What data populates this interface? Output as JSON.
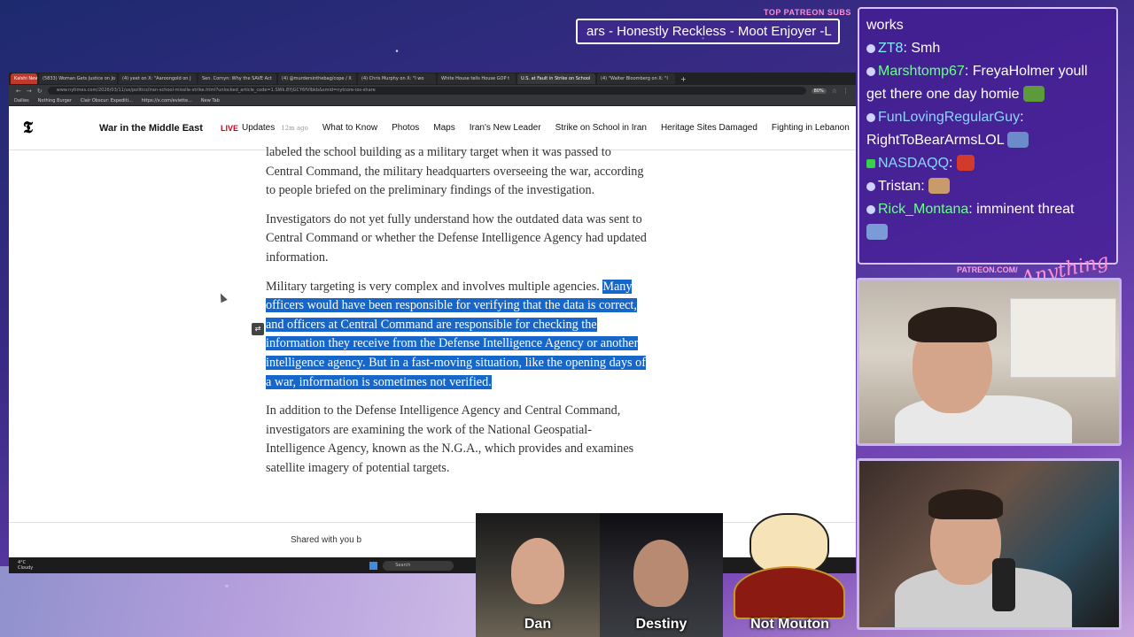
{
  "patreon_banner": {
    "label": "TOP PATREON SUBS",
    "marquee": "ars - Honestly Reckless - Moot Enjoyer -L"
  },
  "browser": {
    "tabs": [
      "Kalshi News",
      "(5833) Woman Gets Justice on Jo",
      "(4) yeet on X: \"Aaroongold on J",
      "Sen. Cornyn: Why the SAVE Act",
      "(4) @murdersinthebag/cope / X",
      "(4) Chris Murphy on X: \"I wo",
      "White House tells House GOP t",
      "U.S. at Fault in Strike on School",
      "(4) \"Walter Bloomberg on X: \"I"
    ],
    "active_tab_index": 7,
    "url": "www.nytimes.com/2026/03/11/us/politics/iran-school-missile-strike.html?unlocked_article_code=1.SWk.8YjGCY6fVIbkb&smid=nytcore-ios-share",
    "zoom": "80%",
    "bookmarks": [
      "Dailies",
      "Nothing Burger",
      "Clair Obscur: Expediti...",
      "https://x.com/eviette...",
      "New Tab"
    ]
  },
  "nyt_nav": {
    "section_title": "War in the Middle East",
    "live_badge": "LIVE",
    "live_label": "Updates",
    "live_time": "12m ago",
    "links": [
      "What to Know",
      "Photos",
      "Maps",
      "Iran's New Leader",
      "Strike on School in Iran",
      "Heritage Sites Damaged",
      "Fighting in Lebanon"
    ]
  },
  "article": {
    "p1": "labeled the school building as a military target when it was passed to Central Command, the military headquarters overseeing the war, according to people briefed on the preliminary findings of the investigation.",
    "p2": "Investigators do not yet fully understand how the outdated data was sent to Central Command or whether the Defense Intelligence Agency had updated information.",
    "p3_lead": "Military targeting is very complex and involves multiple agencies.",
    "p3_highlighted": "Many officers would have been responsible for verifying that the data is correct, and officers at Central Command are responsible for checking the information they receive from the Defense Intelligence Agency or another intelligence agency. But in a fast-moving situation, like the opening days of a war, information is sometimes not verified.",
    "p4": "In addition to the Defense Intelligence Agency and Central Command, investigators are examining the work of the National Geospatial-Intelligence Agency, known as the N.G.A., which provides and examines satellite imagery of potential targets.",
    "shared_text": "Shared with you b"
  },
  "taskbar": {
    "weather_temp": "4°C",
    "weather_desc": "Cloudy",
    "search": "Search"
  },
  "chat": {
    "messages": [
      {
        "user": "",
        "text": "works"
      },
      {
        "user": "ZT8",
        "text": ": Smh"
      },
      {
        "user": "Marshtomp67",
        "text": ": FreyaHolmer youll get there one day homie"
      },
      {
        "user": "FunLovingRegularGuy",
        "text": ": RightToBearArmsLOL"
      },
      {
        "user": "NASDAQQ",
        "text": ":"
      },
      {
        "user": "",
        "text": "Tristan:"
      },
      {
        "user": "Rick_Montana",
        "text": ": imminent threat"
      }
    ]
  },
  "patreon_label": "PATREON.COM/",
  "logo_text": "Anything Else?",
  "guests": [
    {
      "name": "Dan"
    },
    {
      "name": "Destiny"
    },
    {
      "name": "Not Mouton"
    }
  ]
}
